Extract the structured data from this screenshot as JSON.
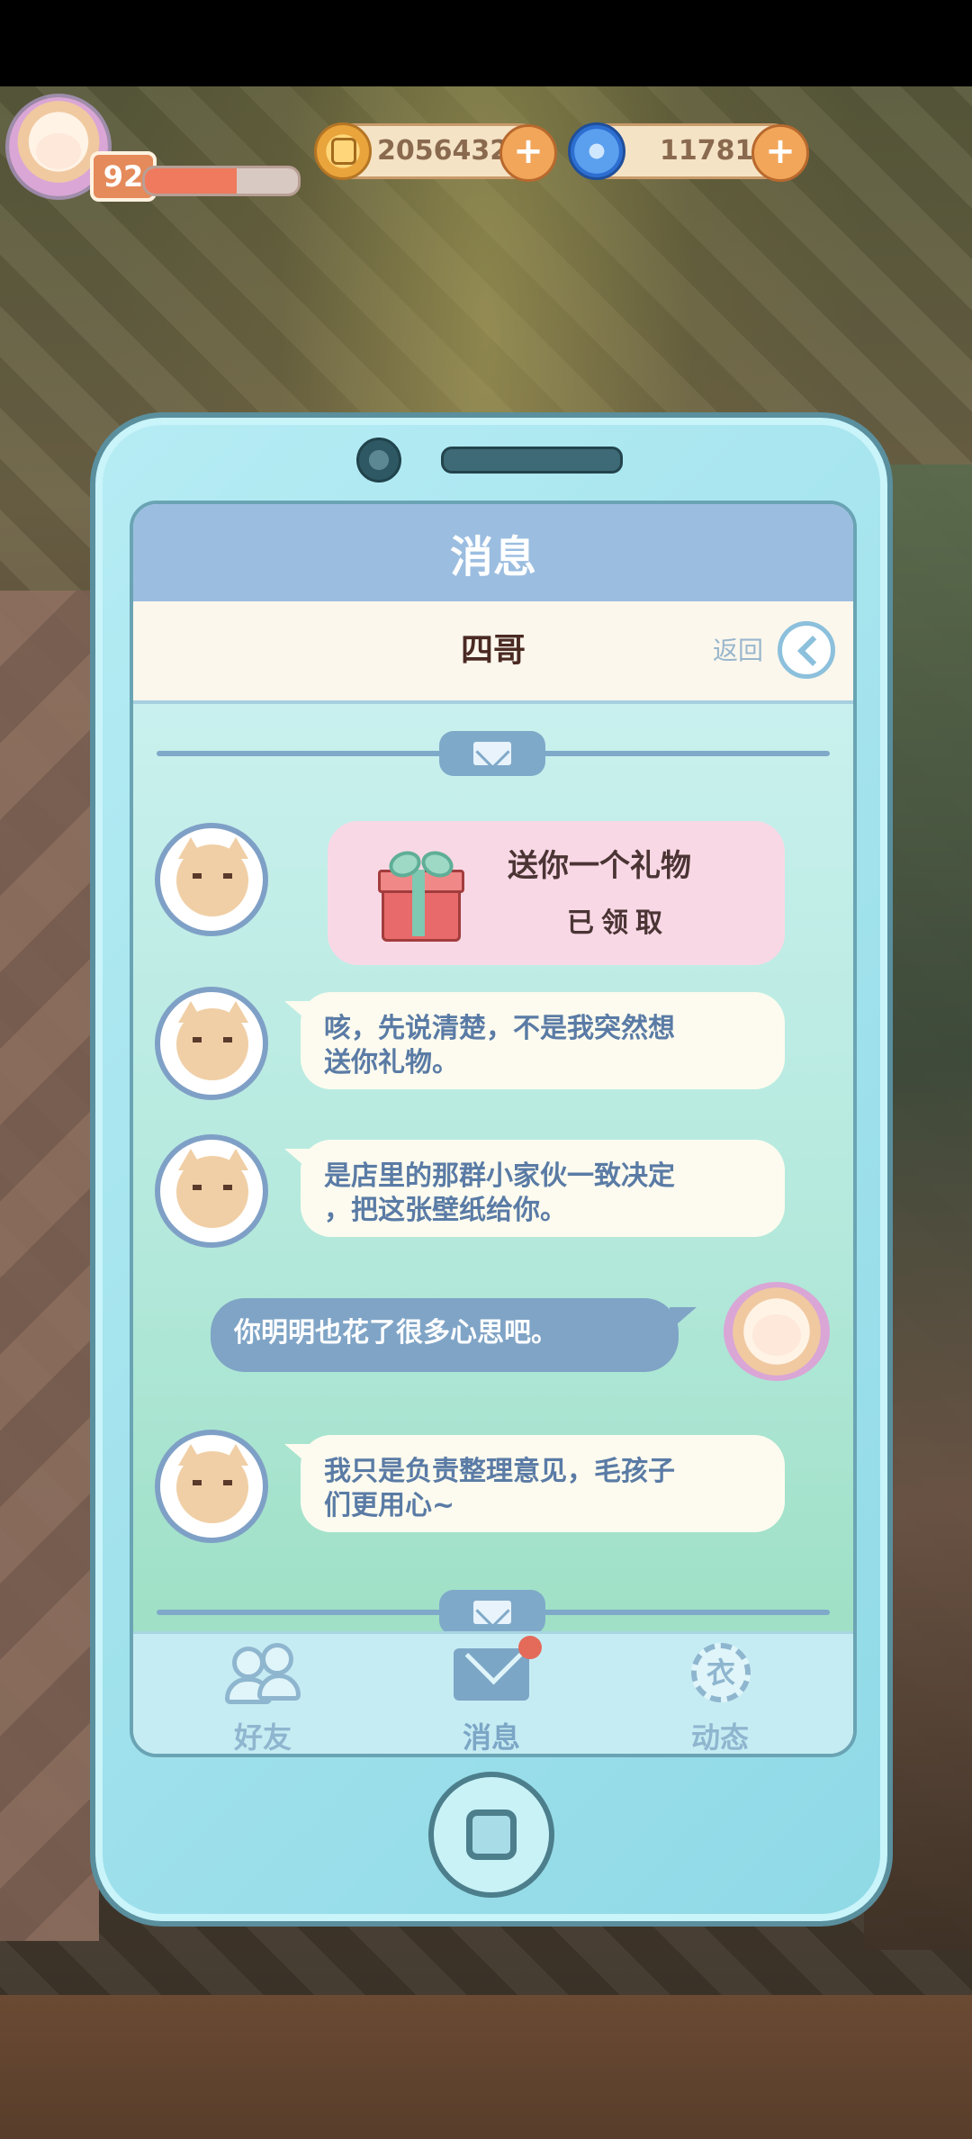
{
  "hud": {
    "level": "92",
    "xp_fraction": 0.6,
    "gold": "2056432",
    "gems": "11781"
  },
  "phone": {
    "header_title": "消息",
    "contact_name": "四哥",
    "back_label": "返回"
  },
  "chat": {
    "gift": {
      "title": "送你一个礼物",
      "status": "已领取"
    },
    "messages": [
      {
        "from": "friend",
        "text_line1": "咳，先说清楚，不是我突然想",
        "text_line2": "送你礼物。"
      },
      {
        "from": "friend",
        "text_line1": "是店里的那群小家伙一致决定",
        "text_line2": "，把这张壁纸给你。"
      },
      {
        "from": "me",
        "text_line1": "你明明也花了很多心思吧。"
      },
      {
        "from": "friend",
        "text_line1": "我只是负责整理意见，毛孩子",
        "text_line2": "们更用心~"
      }
    ]
  },
  "tabs": {
    "friends": "好友",
    "messages": "消息",
    "feed": "动态",
    "feed_glyph": "衣"
  },
  "colors": {
    "phone_body": "#b6ecf4",
    "header": "#9bbde0",
    "gift_card": "#f9d8e5",
    "my_bubble": "#7fa4c6",
    "friend_text": "#5a7ba5",
    "notification": "#e46a5a"
  },
  "icons": [
    "coin-icon",
    "swirl-icon",
    "plus-icon",
    "back-chevron-icon",
    "mail-icon",
    "gift-icon",
    "friends-icon",
    "feed-icon",
    "home-button-icon"
  ]
}
